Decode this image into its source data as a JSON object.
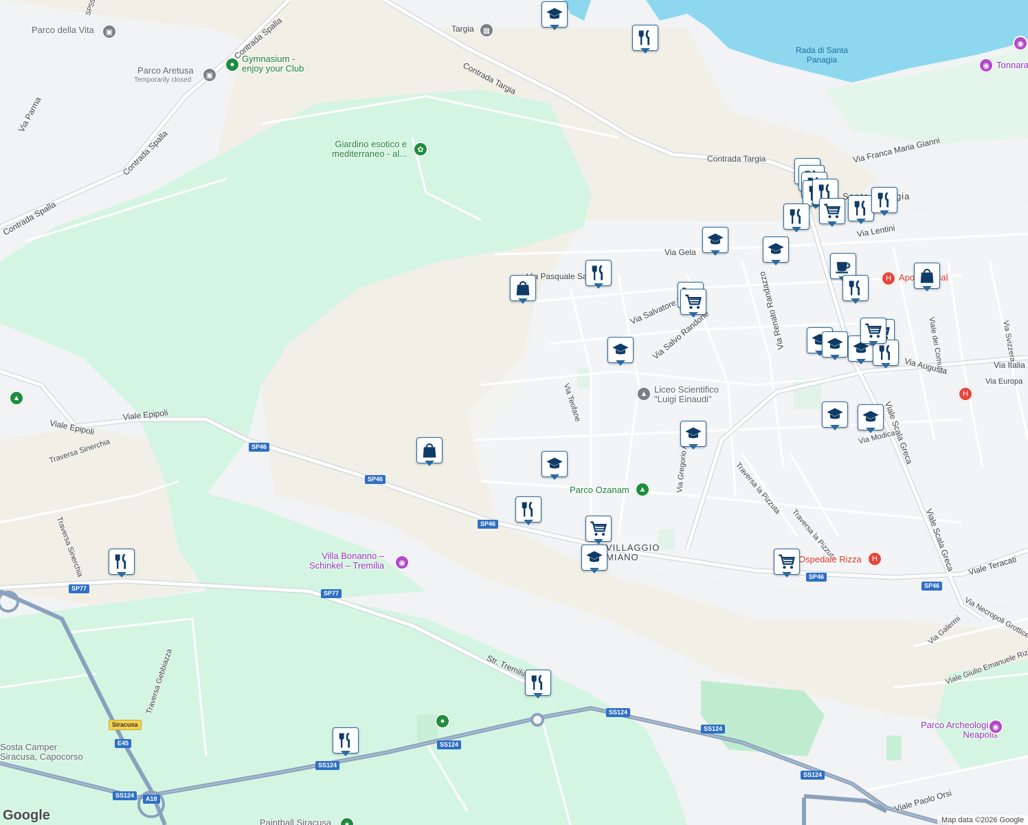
{
  "map": {
    "attribution": "Map data ©2026 Google",
    "logo": "Google",
    "colors": {
      "land": "#f1f3f4",
      "park": "#d4f5e2",
      "sand": "#f2efe6",
      "water": "#8ed8ef",
      "road": "#ffffff",
      "highway": "#8aa1bd",
      "marker_border": "#2c6aa0",
      "marker_icon": "#0f3b66"
    }
  },
  "labels": {
    "targia": "Targia",
    "contrada_targia_1": "Contrada Targia",
    "contrada_targia_2": "Contrada Targia",
    "rada": "Rada di Santa\nPanagia",
    "parco_vita": "Parco della Vita",
    "gymnasium": "Gymnasium -\nenjoy your Club",
    "parco_aretusa": "Parco Aretusa",
    "temp_closed": "Temporarily closed",
    "via_parma": "Via Parma",
    "contrada_spalla_1": "Contrada Spalla",
    "contrada_spalla_2": "Contrada Spalla",
    "contrada_spalla_3": "Contrada Spalla",
    "sp55": "SP55",
    "giardino": "Giardino esotico e\nmediterraneo - al...",
    "via_franca": "Via Franca Maria Gianni",
    "santa_panagia": "Santa Panagia",
    "via_lentini": "Via Lentini",
    "via_gela": "Via Gela",
    "via_pasquale": "Via Pasquale Salibra",
    "via_salvatore": "Via Salvatore Rizza",
    "via_salvo": "Via Salvo Randone",
    "via_renato": "Via Renato Randazzo",
    "apo_medical": "Apo Medical",
    "viale_comuni": "Viale dei Comuni",
    "via_svizzera": "Via Svizzera",
    "via_italia": "Via Italia",
    "via_europa": "Via Europa",
    "via_augusta": "Via Augusta",
    "viale_scala_1": "Viale Scala Greca",
    "viale_scala_2": "Viale Scala Greca",
    "liceo": "Liceo Scientifico\n\"Luigi Einaudi\"",
    "via_teofane": "Via Teofane",
    "via_gregorio": "Via Gregorio Asbesta",
    "via_modica": "Via Modica",
    "traversa_pizzuta_1": "Traversa la Pizzuta",
    "traversa_pizzuta_2": "Traversa la Pizzuta",
    "parco_ozanam": "Parco Ozanam",
    "villaggio": "VILLAGGIO\nMIANO",
    "ospedale": "Ospedale Rizza",
    "viale_teracati": "Viale Teracati",
    "via_necropoli": "Via Necropoli Grotticelle",
    "via_galermi": "Via Galermi",
    "viale_giulio": "Viale Giulio Emanuele Rizzo",
    "parco_archeo": "Parco Archeologico\nNeapolis",
    "viale_paolo": "Viale Paolo Orsi",
    "viale_epipoli_1": "Viale Epipoli",
    "viale_epipoli_2": "Viale Epipoli",
    "traversa_sinerchia_1": "Traversa Sinerchia",
    "traversa_sinerchia_2": "Traversa Sinerchia",
    "villa_bonanno": "Villa Bonanno –\nSchinkel – Tremilia",
    "str_tremilia": "Str. Tremilia",
    "traversa_gebbiazza": "Traversa Gebbiazza",
    "sosta_camper": "Sosta Camper\nSiracusa, Capocorso",
    "paintball": "Paintball Siracusa",
    "tonnara": "Tonnara",
    "siracusa_sign": "Siracusa"
  },
  "shields": {
    "sp46_a": "SP46",
    "sp46_b": "SP46",
    "sp46_c": "SP46",
    "sp46_d": "SP46",
    "sp46_e": "SP46",
    "sp77_a": "SP77",
    "sp77_b": "SP77",
    "ss124_a": "SS124",
    "ss124_b": "SS124",
    "ss124_c": "SS124",
    "ss124_d": "SS124",
    "ss124_e": "SS124",
    "ss124_f": "SS124",
    "e45": "E45",
    "a18": "A18"
  },
  "markers": [
    {
      "type": "school"
    },
    {
      "type": "restaurant"
    },
    {
      "type": "school"
    },
    {
      "type": "restaurant"
    },
    {
      "type": "restaurant"
    },
    {
      "type": "restaurant"
    },
    {
      "type": "restaurant"
    },
    {
      "type": "restaurant"
    },
    {
      "type": "grocery"
    },
    {
      "type": "restaurant"
    },
    {
      "type": "restaurant"
    },
    {
      "type": "school"
    },
    {
      "type": "school"
    },
    {
      "type": "cafe"
    },
    {
      "type": "shopping"
    },
    {
      "type": "restaurant"
    },
    {
      "type": "shopping"
    },
    {
      "type": "restaurant"
    },
    {
      "type": "grocery"
    },
    {
      "type": "grocery"
    },
    {
      "type": "school"
    },
    {
      "type": "school"
    },
    {
      "type": "school"
    },
    {
      "type": "grocery"
    },
    {
      "type": "school"
    },
    {
      "type": "restaurant"
    },
    {
      "type": "grocery"
    },
    {
      "type": "school"
    },
    {
      "type": "school"
    },
    {
      "type": "school"
    },
    {
      "type": "shopping"
    },
    {
      "type": "school"
    },
    {
      "type": "restaurant"
    },
    {
      "type": "grocery"
    },
    {
      "type": "school"
    },
    {
      "type": "grocery"
    },
    {
      "type": "restaurant"
    },
    {
      "type": "restaurant"
    },
    {
      "type": "restaurant"
    }
  ]
}
